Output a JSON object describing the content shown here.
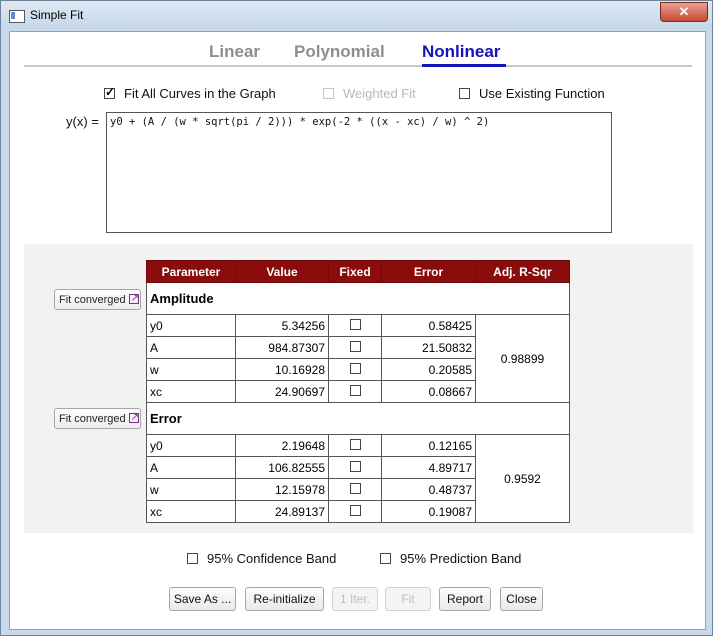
{
  "window": {
    "title": "Simple Fit",
    "close_glyph": "✕"
  },
  "tabs": [
    {
      "label": "Linear",
      "active": false
    },
    {
      "label": "Polynomial",
      "active": false
    },
    {
      "label": "Nonlinear",
      "active": true
    }
  ],
  "options": {
    "fit_all": {
      "label": "Fit All Curves in the Graph",
      "checked": true
    },
    "weighted": {
      "label": "Weighted Fit",
      "checked": false,
      "disabled": true
    },
    "existing": {
      "label": "Use Existing Function",
      "checked": false
    }
  },
  "function": {
    "label": "y(x) =",
    "expression": "y0 + (A / (w * sqrt(pi / 2))) * exp(-2 * ((x - xc) / w) ^ 2)"
  },
  "table": {
    "headers": [
      "Parameter",
      "Value",
      "Fixed",
      "Error",
      "Adj. R-Sqr"
    ],
    "groups": [
      {
        "name": "Amplitude",
        "status": "Fit converged",
        "adj_r_sqr": "0.98899",
        "rows": [
          {
            "param": "y0",
            "value": "5.34256",
            "fixed": false,
            "error": "0.58425"
          },
          {
            "param": "A",
            "value": "984.87307",
            "fixed": false,
            "error": "21.50832"
          },
          {
            "param": "w",
            "value": "10.16928",
            "fixed": false,
            "error": "0.20585"
          },
          {
            "param": "xc",
            "value": "24.90697",
            "fixed": false,
            "error": "0.08667"
          }
        ]
      },
      {
        "name": "Error",
        "status": "Fit converged",
        "adj_r_sqr": "0.9592",
        "rows": [
          {
            "param": "y0",
            "value": "2.19648",
            "fixed": false,
            "error": "0.12165"
          },
          {
            "param": "A",
            "value": "106.82555",
            "fixed": false,
            "error": "4.89717"
          },
          {
            "param": "w",
            "value": "12.15978",
            "fixed": false,
            "error": "0.48737"
          },
          {
            "param": "xc",
            "value": "24.89137",
            "fixed": false,
            "error": "0.19087"
          }
        ]
      }
    ]
  },
  "bands": {
    "confidence": {
      "label": "95% Confidence Band",
      "checked": false
    },
    "prediction": {
      "label": "95% Prediction Band",
      "checked": false
    }
  },
  "buttons": {
    "save_as": "Save As ...",
    "reinitialize": "Re-initialize",
    "one_iter": "1 Iter.",
    "fit": "Fit",
    "report": "Report",
    "close": "Close"
  }
}
